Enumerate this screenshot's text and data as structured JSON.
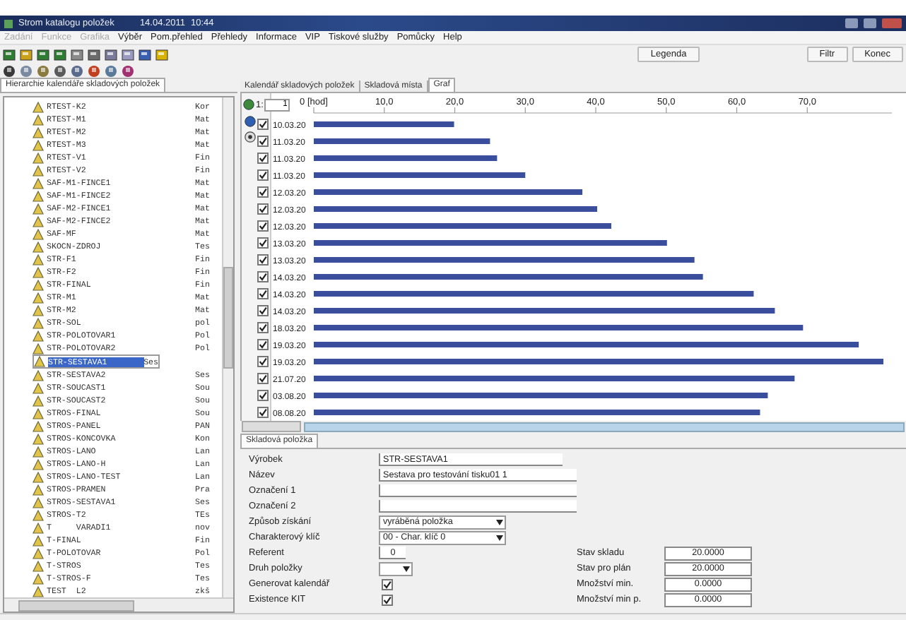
{
  "window": {
    "title": "Strom katalogu položek",
    "date": "14.04.2011",
    "time": "10:44"
  },
  "menu": [
    {
      "label": "Zadání",
      "disabled": true
    },
    {
      "label": "Funkce",
      "disabled": true
    },
    {
      "label": "Grafika",
      "disabled": true
    },
    {
      "label": "Výběr",
      "disabled": false
    },
    {
      "label": "Pom.přehled",
      "disabled": false
    },
    {
      "label": "Přehledy",
      "disabled": false
    },
    {
      "label": "Informace",
      "disabled": false
    },
    {
      "label": "VIP",
      "disabled": false
    },
    {
      "label": "Tiskové služby",
      "disabled": false
    },
    {
      "label": "Pomůcky",
      "disabled": false
    },
    {
      "label": "Help",
      "disabled": false
    }
  ],
  "toolbar_buttons": [
    "Legenda",
    "Filtr",
    "Konec"
  ],
  "left_tab": {
    "label": "Hierarchie kalendáře skladových položek"
  },
  "tree": [
    {
      "code": "RTEST-K2",
      "type": "Kor",
      "selected": false
    },
    {
      "code": "RTEST-M1",
      "type": "Mat",
      "selected": false
    },
    {
      "code": "RTEST-M2",
      "type": "Mat",
      "selected": false
    },
    {
      "code": "RTEST-M3",
      "type": "Mat",
      "selected": false
    },
    {
      "code": "RTEST-V1",
      "type": "Fin",
      "selected": false
    },
    {
      "code": "RTEST-V2",
      "type": "Fin",
      "selected": false
    },
    {
      "code": "SAF-M1-FINCE1",
      "type": "Mat",
      "selected": false
    },
    {
      "code": "SAF-M1-FINCE2",
      "type": "Mat",
      "selected": false
    },
    {
      "code": "SAF-M2-FINCE1",
      "type": "Mat",
      "selected": false
    },
    {
      "code": "SAF-M2-FINCE2",
      "type": "Mat",
      "selected": false
    },
    {
      "code": "SAF-MF",
      "type": "Mat",
      "selected": false
    },
    {
      "code": "SKOCN-ZDROJ",
      "type": "Tes",
      "selected": false
    },
    {
      "code": "STR-F1",
      "type": "Fin",
      "selected": false
    },
    {
      "code": "STR-F2",
      "type": "Fin",
      "selected": false
    },
    {
      "code": "STR-FINAL",
      "type": "Fin",
      "selected": false
    },
    {
      "code": "STR-M1",
      "type": "Mat",
      "selected": false
    },
    {
      "code": "STR-M2",
      "type": "Mat",
      "selected": false
    },
    {
      "code": "STR-SOL",
      "type": "pol",
      "selected": false
    },
    {
      "code": "STR-POLOTOVAR1",
      "type": "Pol",
      "selected": false
    },
    {
      "code": "STR-POLOTOVAR2",
      "type": "Pol",
      "selected": false
    },
    {
      "code": "STR-SESTAVA1",
      "type": "Ses",
      "selected": true
    },
    {
      "code": "STR-SESTAVA2",
      "type": "Ses",
      "selected": false
    },
    {
      "code": "STR-SOUCAST1",
      "type": "Sou",
      "selected": false
    },
    {
      "code": "STR-SOUCAST2",
      "type": "Sou",
      "selected": false
    },
    {
      "code": "STROS-FINAL",
      "type": "Sou",
      "selected": false
    },
    {
      "code": "STROS-PANEL",
      "type": "PAN",
      "selected": false
    },
    {
      "code": "STROS-KONCOVKA",
      "type": "Kon",
      "selected": false
    },
    {
      "code": "STROS-LANO",
      "type": "Lan",
      "selected": false
    },
    {
      "code": "STROS-LANO-H",
      "type": "Lan",
      "selected": false
    },
    {
      "code": "STROS-LANO-TEST",
      "type": "Lan",
      "selected": false
    },
    {
      "code": "STROS-PRAMEN",
      "type": "Pra",
      "selected": false
    },
    {
      "code": "STROS-SESTAVA1",
      "type": "Ses",
      "selected": false
    },
    {
      "code": "STROS-T2",
      "type": "TEs",
      "selected": false
    },
    {
      "code": "T     VARADI1",
      "type": "nov",
      "selected": false
    },
    {
      "code": "T-FINAL",
      "type": "Fin",
      "selected": false
    },
    {
      "code": "T-POLOTOVAR",
      "type": "Pol",
      "selected": false
    },
    {
      "code": "T-STROS",
      "type": "Tes",
      "selected": false
    },
    {
      "code": "T-STROS-F",
      "type": "Tes",
      "selected": false
    },
    {
      "code": "TEST  L2",
      "type": "zkš",
      "selected": false
    }
  ],
  "tabs": [
    {
      "label": "Kalendář skladových položek",
      "selected": false
    },
    {
      "label": "Skladová místa",
      "selected": false
    },
    {
      "label": "Graf",
      "selected": true
    }
  ],
  "chart_toolbar": {
    "page_label": "1:",
    "page_value": "1"
  },
  "chart_rows": [
    {
      "checked": true
    },
    {
      "checked": true
    },
    {
      "checked": true
    },
    {
      "checked": true
    },
    {
      "checked": true
    },
    {
      "checked": true
    },
    {
      "checked": true
    },
    {
      "checked": true
    },
    {
      "checked": true
    },
    {
      "checked": true
    },
    {
      "checked": true
    },
    {
      "checked": true
    },
    {
      "checked": true
    },
    {
      "checked": true
    },
    {
      "checked": true
    },
    {
      "checked": true
    },
    {
      "checked": true
    },
    {
      "checked": true
    }
  ],
  "chart_data": {
    "type": "bar",
    "orientation": "horizontal",
    "categories": [
      "10.03.20",
      "11.03.20",
      "11.03.20",
      "11.03.20",
      "12.03.20",
      "12.03.20",
      "12.03.20",
      "13.03.20",
      "13.03.20",
      "14.03.20",
      "14.03.20",
      "14.03.20",
      "18.03.20",
      "19.03.20",
      "19.03.20",
      "21.07.20",
      "03.08.20",
      "08.08.20"
    ],
    "values": [
      19.9,
      25,
      26,
      30,
      38.1,
      40.2,
      42.2,
      50.1,
      54,
      55.2,
      62.4,
      65.4,
      69.4,
      77.3,
      80.8,
      68.2,
      64.4,
      63.3
    ],
    "xlim": [
      0,
      82
    ],
    "xticks": [
      {
        "value": 0,
        "label": "0 [hod]"
      },
      {
        "value": 10,
        "label": "10,0"
      },
      {
        "value": 20,
        "label": "20,0"
      },
      {
        "value": 30,
        "label": "30,0"
      },
      {
        "value": 40,
        "label": "40,0"
      },
      {
        "value": 50,
        "label": "50,0"
      },
      {
        "value": 60,
        "label": "60,0"
      },
      {
        "value": 70,
        "label": "70,0"
      }
    ]
  },
  "form_tab": {
    "label": "Skladová položka"
  },
  "form_fields": [
    {
      "label": "Výrobek",
      "kind": "code",
      "value": "STR-SESTAVA1"
    },
    {
      "label": "Název",
      "kind": "text",
      "value": "Sestava pro testování tisku01 1"
    },
    {
      "label": "Označení 1",
      "kind": "text"
    },
    {
      "label": "Označení 2",
      "kind": "text"
    },
    {
      "label": "Způsob získání",
      "kind": "select",
      "value": "vyráběná položka"
    },
    {
      "label": "Charakterový klíč",
      "kind": "select",
      "value": "00 - Char. klíč 0"
    },
    {
      "label": "Referent",
      "kind": "short",
      "value": "0"
    },
    {
      "label": "Druh položky",
      "kind": "small_select"
    },
    {
      "label": "Generovat kalendář",
      "kind": "check",
      "checked": true
    },
    {
      "label": "Existence KIT",
      "kind": "check",
      "checked": true
    }
  ],
  "stock": [
    {
      "label": "Stav skladu",
      "value": "20.0000"
    },
    {
      "label": "Stav pro plán",
      "value": "20.0000"
    },
    {
      "label": "Množství min.",
      "value": "0.0000"
    },
    {
      "label": "Množství min p.",
      "value": "0.0000"
    }
  ]
}
